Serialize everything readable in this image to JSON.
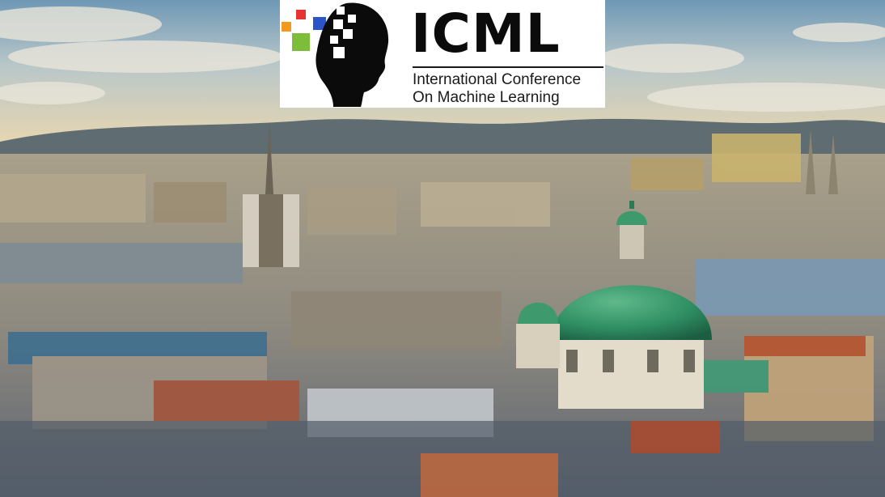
{
  "photo": {
    "subject": "vienna-skyline-photo"
  },
  "logo": {
    "title": "ICML",
    "subtitle_line1": "International Conference",
    "subtitle_line2": "On Machine Learning",
    "icon": "head-silhouette-with-pixel-squares-icon",
    "square_colors": [
      "#e63333",
      "#2a54c8",
      "#f29a1f",
      "#7cbd3a"
    ]
  }
}
